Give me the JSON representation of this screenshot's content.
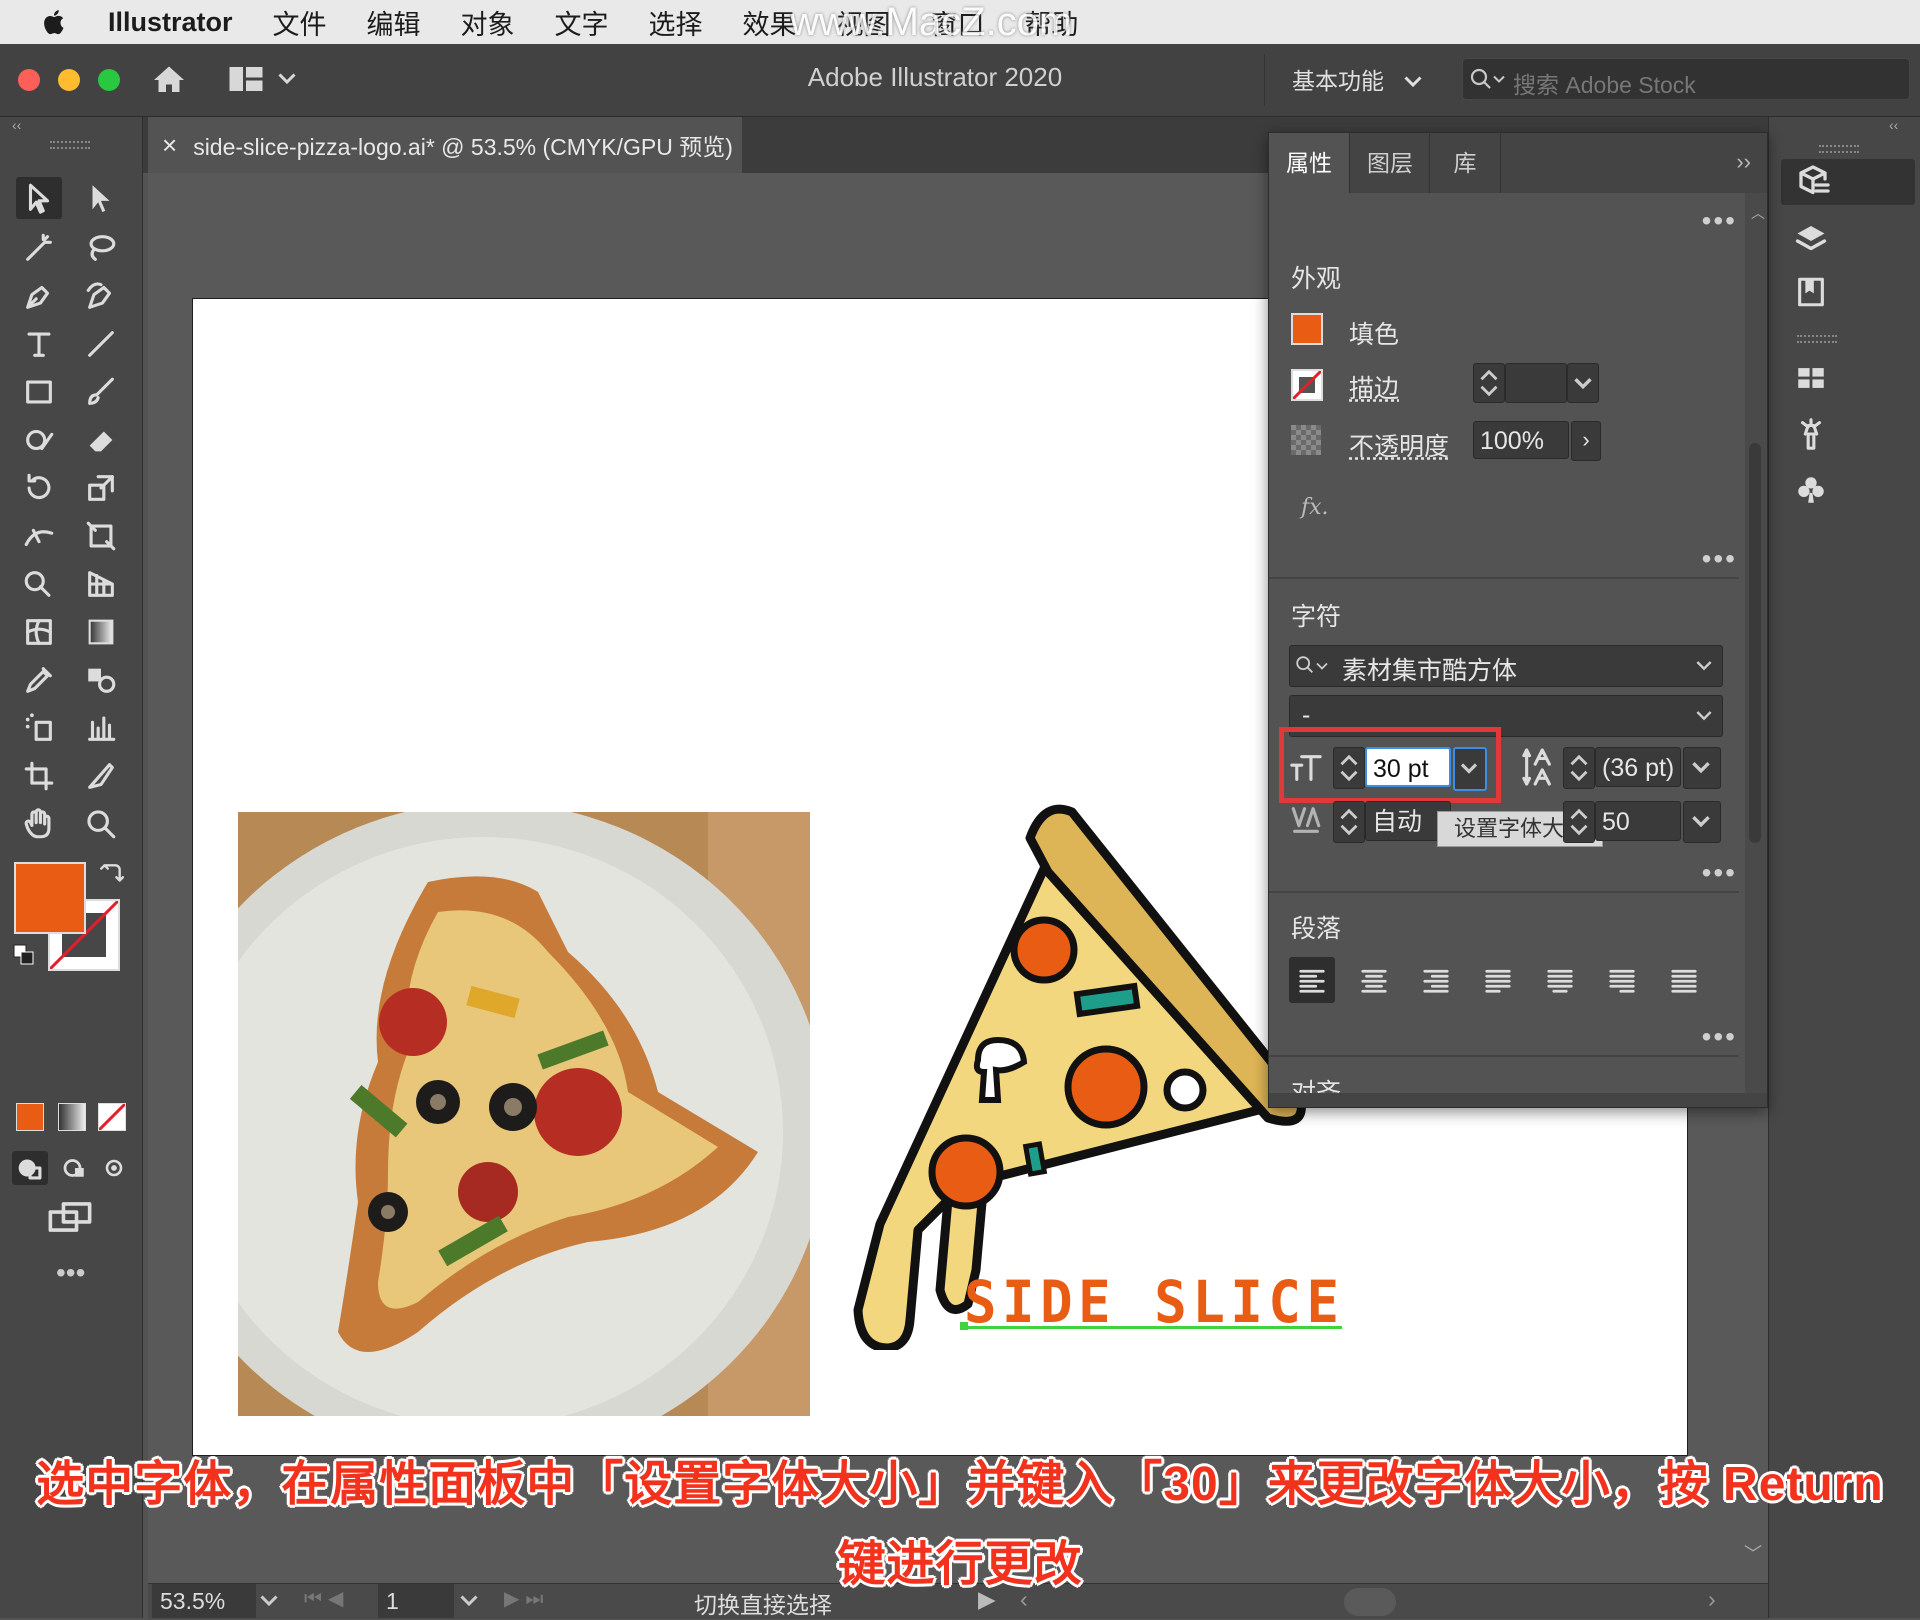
{
  "menubar": {
    "app": "Illustrator",
    "items": [
      "文件",
      "编辑",
      "对象",
      "文字",
      "选择",
      "效果",
      "视图",
      "窗口",
      "帮助"
    ]
  },
  "watermark": "www.MacZ.com",
  "titlebar": {
    "title": "Adobe Illustrator 2020",
    "workspace": "基本功能",
    "search_placeholder": "搜索 Adobe Stock"
  },
  "document_tab": {
    "close": "×",
    "title": "side-slice-pizza-logo.ai* @ 53.5% (CMYK/GPU 预览)"
  },
  "panel": {
    "tabs": [
      "属性",
      "图层",
      "库"
    ],
    "active_tab": "属性",
    "appearance": {
      "title": "外观",
      "fill_label": "填色",
      "stroke_label": "描边",
      "opacity_label": "不透明度",
      "opacity_value": "100%",
      "fx": "fx."
    },
    "character": {
      "title": "字符",
      "font_family": "素材集市酷方体",
      "font_style": "-",
      "font_size": "30 pt",
      "leading": "(36 pt)",
      "kerning": "自动",
      "tracking": "50",
      "tooltip": "设置字体大小"
    },
    "paragraph": {
      "title": "段落"
    },
    "next_section": "对齐",
    "more": "•••"
  },
  "artwork": {
    "logo_text": "SIDE SLICE"
  },
  "statusbar": {
    "zoom": "53.5%",
    "artboard_number": "1",
    "tool_hint": "切换直接选择"
  },
  "caption": {
    "line1": "选中字体，在属性面板中「设置字体大小」并键入「30」来更改字体大小，按 Return",
    "line2": "键进行更改"
  },
  "colors": {
    "fill_swatch": "#e85c13",
    "highlight_box": "#e0393a",
    "caption_text": "#f2321c"
  },
  "icons": [
    "apple-icon",
    "home-icon",
    "layout-icon",
    "search-icon",
    "selection-tool-icon",
    "direct-selection-tool-icon",
    "type-tool-icon",
    "pen-tool-icon",
    "hand-tool-icon",
    "zoom-tool-icon",
    "properties-icon",
    "layers-icon",
    "libraries-icon"
  ]
}
